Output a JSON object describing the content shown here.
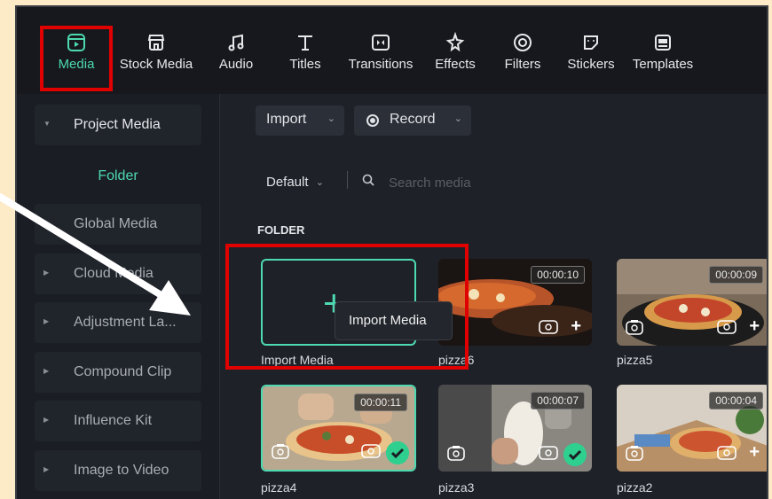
{
  "toolbar": {
    "items": [
      {
        "label": "Media",
        "icon": "media-icon",
        "active": true
      },
      {
        "label": "Stock Media",
        "icon": "store-icon"
      },
      {
        "label": "Audio",
        "icon": "music-icon"
      },
      {
        "label": "Titles",
        "icon": "titles-icon"
      },
      {
        "label": "Transitions",
        "icon": "transitions-icon"
      },
      {
        "label": "Effects",
        "icon": "effects-icon"
      },
      {
        "label": "Filters",
        "icon": "filters-icon"
      },
      {
        "label": "Stickers",
        "icon": "stickers-icon"
      },
      {
        "label": "Templates",
        "icon": "templates-icon"
      }
    ]
  },
  "sidebar": {
    "items": [
      {
        "label": "Project Media",
        "expanded": true
      },
      {
        "label": "Folder"
      },
      {
        "label": "Global Media"
      },
      {
        "label": "Cloud Media"
      },
      {
        "label": "Adjustment La..."
      },
      {
        "label": "Compound Clip"
      },
      {
        "label": "Influence Kit"
      },
      {
        "label": "Image to Video"
      }
    ]
  },
  "main": {
    "import_button": "Import",
    "record_button": "Record",
    "sort": "Default",
    "search_placeholder": "Search media",
    "section": "FOLDER",
    "import_label": "Import Media",
    "tooltip": "Import Media",
    "tiles": [
      {
        "name": "pizza6",
        "duration": "00:00:10"
      },
      {
        "name": "pizza5",
        "duration": "00:00:09"
      },
      {
        "name": "pizza4",
        "duration": "00:00:11",
        "used": true
      },
      {
        "name": "pizza3",
        "duration": "00:00:07",
        "used": true
      },
      {
        "name": "pizza2",
        "duration": "00:00:04"
      }
    ]
  },
  "colors": {
    "accent": "#4dd9b1",
    "highlight": "#e00000",
    "background": "#fdebc8"
  }
}
